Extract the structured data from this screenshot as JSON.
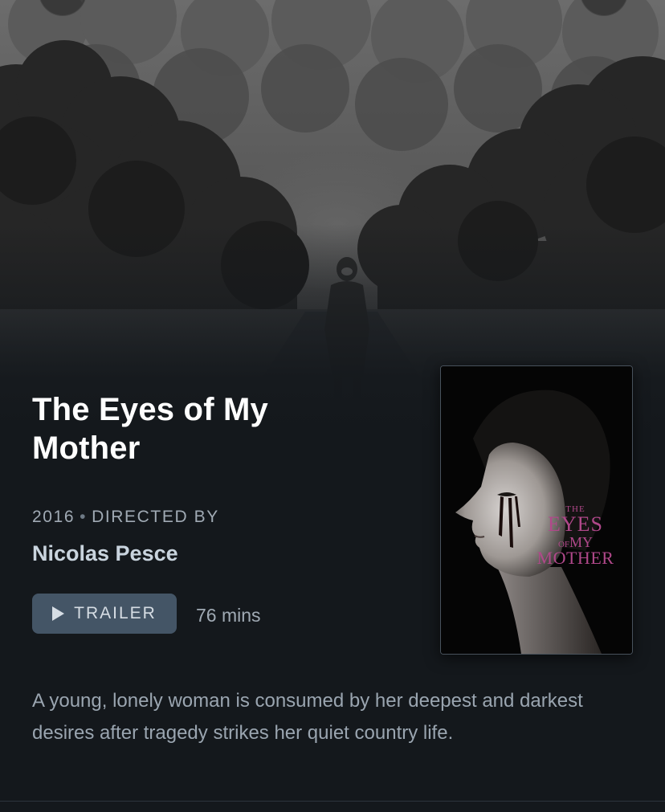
{
  "film": {
    "title": "The Eyes of My Mother",
    "year": "2016",
    "separator": "•",
    "directed_by_label": "DIRECTED BY",
    "director": "Nicolas Pesce",
    "trailer_label": "TRAILER",
    "runtime": "76 mins",
    "synopsis": "A young, lonely woman is consumed by her deepest and darkest desires after tragedy strikes her quiet country life."
  },
  "poster": {
    "line_the": "THE",
    "line_eyes": "EYES",
    "line_of": "OF",
    "line_my": "MY",
    "line_mother": "MOTHER",
    "text_color": "#b0488a"
  },
  "icons": {
    "trailer": "play-icon"
  },
  "colors": {
    "background": "#14181c",
    "title": "#ffffff",
    "director": "#c9d4de",
    "button": "#445566",
    "muted": "#a0aab4"
  }
}
